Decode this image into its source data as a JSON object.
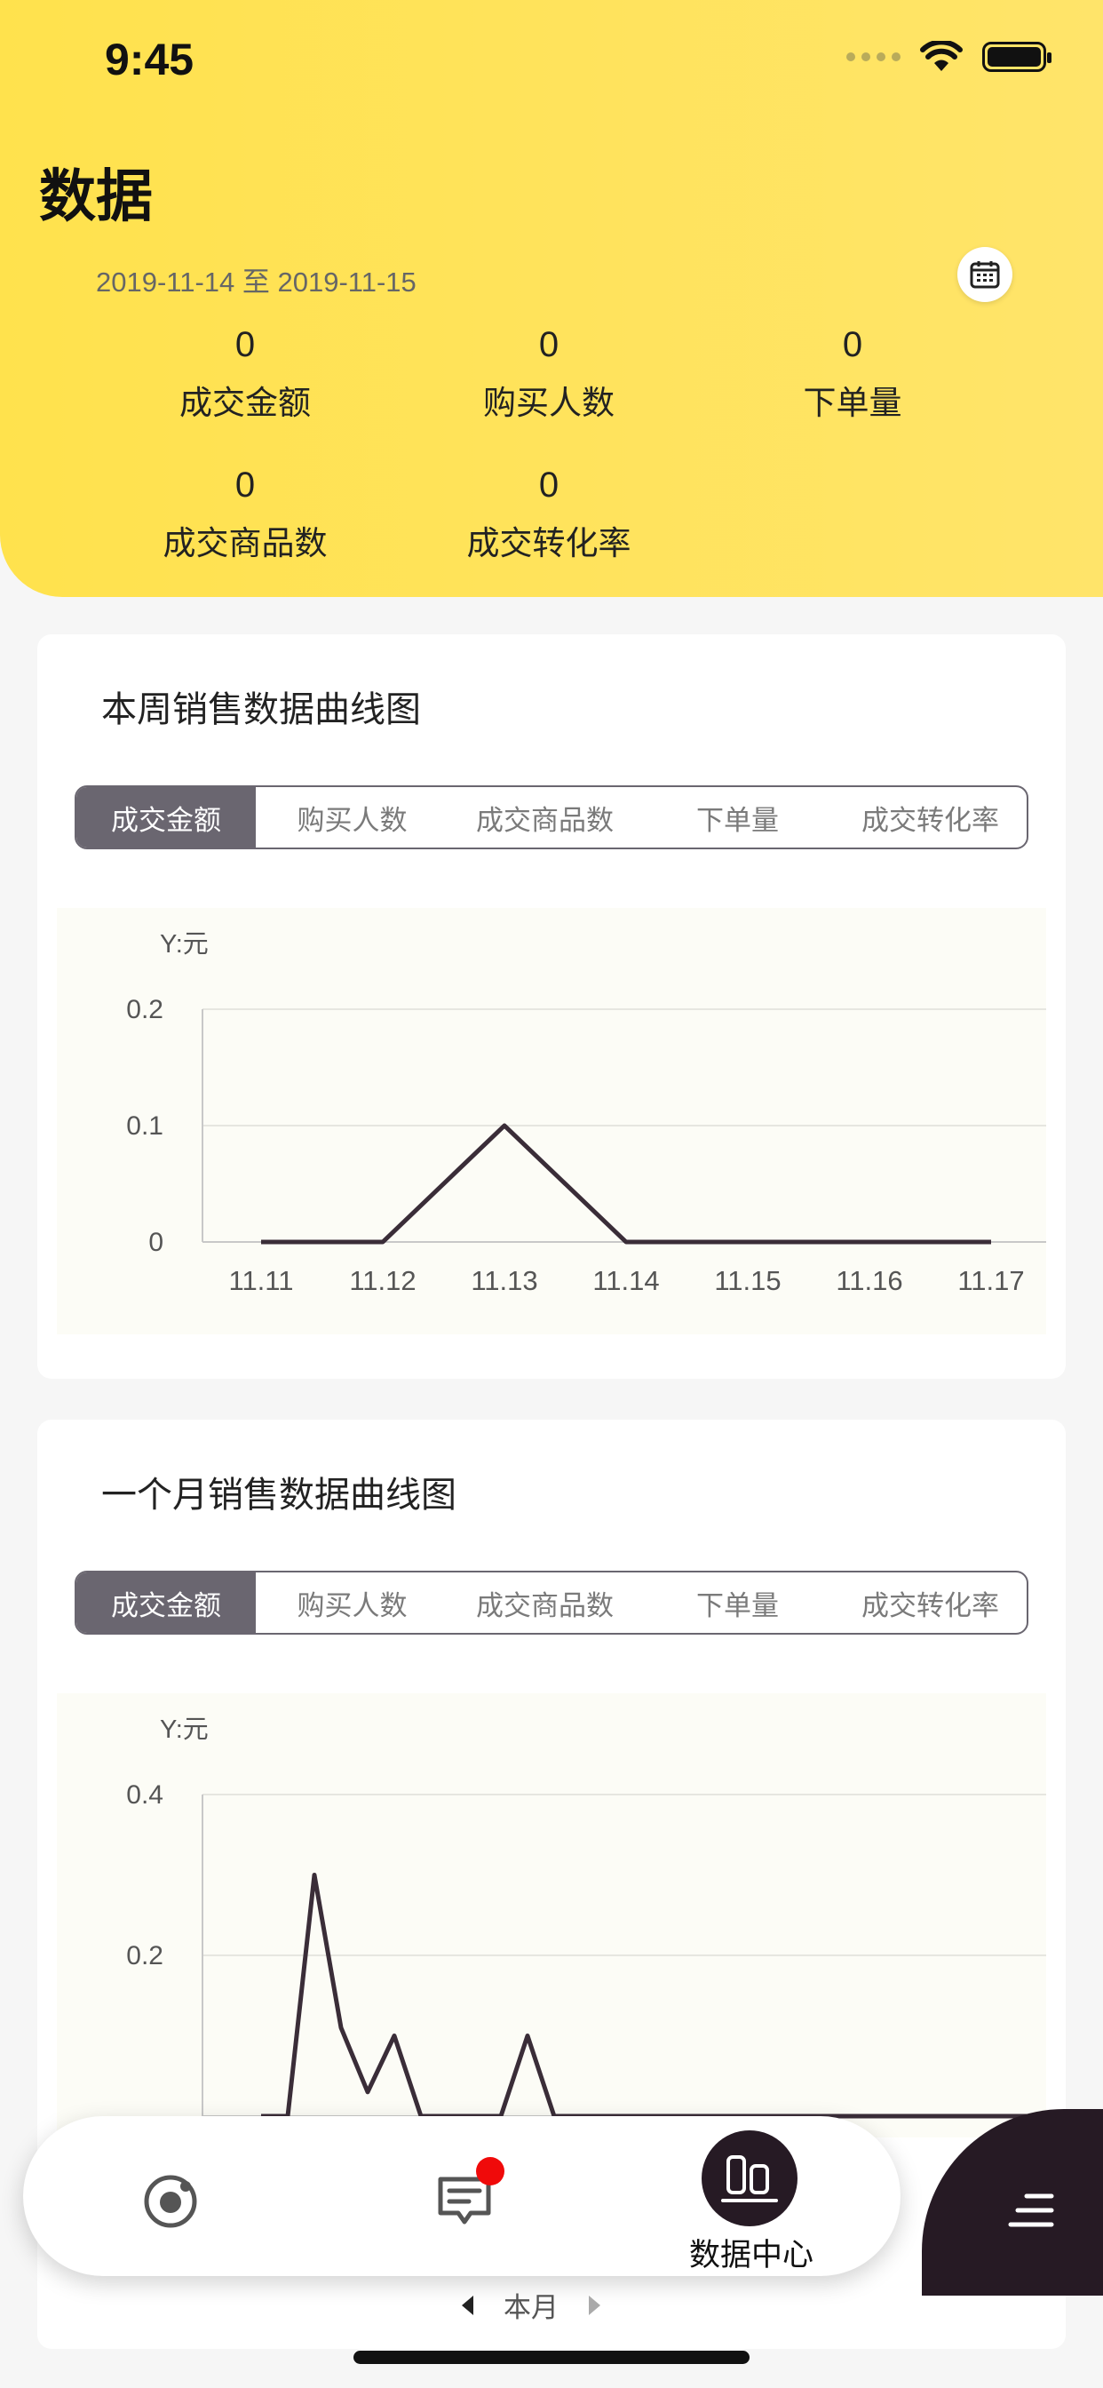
{
  "status": {
    "time": "9:45"
  },
  "header": {
    "title": "数据",
    "date_range": "2019-11-14 至 2019-11-15",
    "stats": [
      {
        "value": "0",
        "label": "成交金额"
      },
      {
        "value": "0",
        "label": "购买人数"
      },
      {
        "value": "0",
        "label": "下单量"
      },
      {
        "value": "0",
        "label": "成交商品数"
      },
      {
        "value": "0",
        "label": "成交转化率"
      }
    ]
  },
  "tabs": [
    "成交金额",
    "购买人数",
    "成交商品数",
    "下单量",
    "成交转化率"
  ],
  "weekly": {
    "title": "本周销售数据曲线图",
    "y_unit": "Y:元"
  },
  "monthly": {
    "title": "一个月销售数据曲线图",
    "y_unit": "Y:元"
  },
  "nav": {
    "active_label": "数据中心"
  },
  "pager": {
    "label": "本月"
  },
  "colors": {
    "header_yellow": "#ffe24d",
    "dark": "#261a24",
    "tab_active": "#6a6670",
    "badge": "#f00a0a"
  },
  "chart_data": [
    {
      "type": "line",
      "title": "本周销售数据曲线图",
      "ylabel": "Y:元",
      "categories": [
        "11.11",
        "11.12",
        "11.13",
        "11.14",
        "11.15",
        "11.16",
        "11.17"
      ],
      "values": [
        0,
        0,
        0.1,
        0,
        0,
        0,
        0
      ],
      "yticks": [
        0,
        0.1,
        0.2
      ],
      "ylim": [
        0,
        0.2
      ]
    },
    {
      "type": "line",
      "title": "一个月销售数据曲线图",
      "ylabel": "Y:元",
      "values": [
        0,
        0,
        0.3,
        0.11,
        0.03,
        0.1,
        0,
        0,
        0,
        0,
        0.1,
        0,
        0,
        0,
        0,
        0,
        0,
        0,
        0,
        0,
        0,
        0,
        0,
        0,
        0,
        0,
        0,
        0,
        0,
        0
      ],
      "yticks": [
        0.2,
        0.4
      ],
      "ylim": [
        0,
        0.4
      ]
    }
  ]
}
